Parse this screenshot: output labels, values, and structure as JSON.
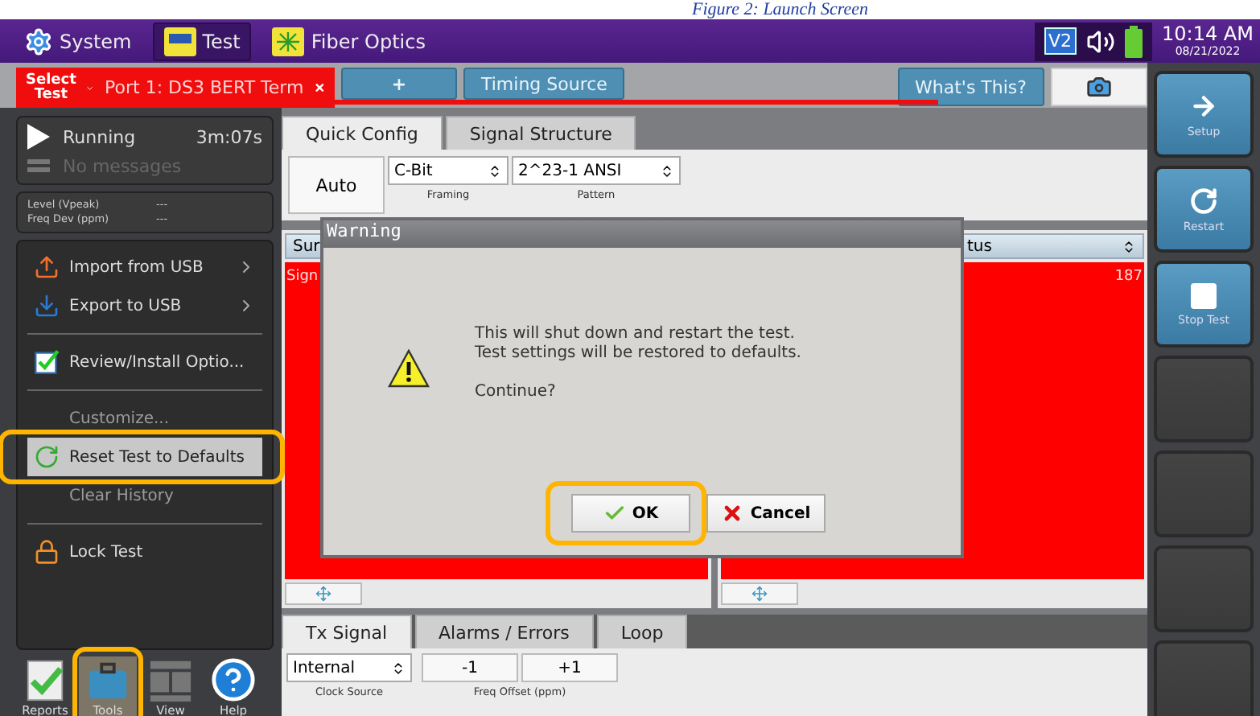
{
  "caption": "Figure 2: Launch Screen",
  "top_bar": {
    "tabs": [
      {
        "label": "System",
        "selected": false
      },
      {
        "label": "Test",
        "selected": true
      },
      {
        "label": "Fiber Optics",
        "selected": false
      }
    ],
    "badge": "V2",
    "time": "10:14 AM",
    "date": "08/21/2022"
  },
  "test_bar": {
    "select_label": "Select Test",
    "port_tab": "Port 1: DS3 BERT Term",
    "add": "+",
    "timing": "Timing Source",
    "whats_this": "What's This?"
  },
  "status_panel": {
    "state": "Running",
    "elapsed": "3m:07s",
    "message": "No messages",
    "readings": [
      {
        "label": "Level (Vpeak)",
        "value": "---"
      },
      {
        "label": "Freq Dev (ppm)",
        "value": "---"
      }
    ]
  },
  "menu": [
    {
      "kind": "submenu",
      "label": "Import from USB",
      "selected": false,
      "disabled": false
    },
    {
      "kind": "submenu",
      "label": "Export to USB",
      "selected": false,
      "disabled": false
    },
    {
      "kind": "divider"
    },
    {
      "kind": "plain",
      "label": "Review/Install Optio...",
      "selected": false,
      "disabled": false
    },
    {
      "kind": "divider"
    },
    {
      "kind": "plain",
      "label": "Customize...",
      "selected": false,
      "disabled": true
    },
    {
      "kind": "plain",
      "label": "Reset Test to Defaults",
      "selected": true,
      "disabled": false
    },
    {
      "kind": "plain",
      "label": "Clear History",
      "selected": false,
      "disabled": true
    },
    {
      "kind": "divider"
    },
    {
      "kind": "plain",
      "label": "Lock Test",
      "selected": false,
      "disabled": false
    }
  ],
  "dock": [
    {
      "label": "Reports",
      "selected": false
    },
    {
      "label": "Tools",
      "selected": true
    },
    {
      "label": "View",
      "selected": false
    },
    {
      "label": "Help",
      "selected": false
    }
  ],
  "config_tabs": [
    {
      "label": "Quick Config",
      "selected": true
    },
    {
      "label": "Signal Structure",
      "selected": false
    }
  ],
  "config": {
    "auto": "Auto",
    "fields": [
      {
        "value": "C-Bit",
        "caption": "Framing"
      },
      {
        "value": "2^23-1 ANSI",
        "caption": "Pattern"
      }
    ]
  },
  "result_panels": [
    {
      "header": "Sur",
      "row_label": "Sign"
    },
    {
      "header": "tus",
      "value": "187"
    }
  ],
  "bottom_tabs": [
    {
      "label": "Tx Signal",
      "selected": true
    },
    {
      "label": "Alarms / Errors",
      "selected": false
    },
    {
      "label": "Loop",
      "selected": false
    }
  ],
  "tx_signal": {
    "clock": {
      "value": "Internal",
      "caption": "Clock Source"
    },
    "offset_buttons": [
      "-1",
      "+1"
    ],
    "offset_caption": "Freq Offset (ppm)"
  },
  "dialog": {
    "title": "Warning",
    "message": [
      "This will shut down and restart the test.",
      "Test settings will be restored to defaults."
    ],
    "question": "Continue?",
    "buttons": [
      {
        "kind": "ok",
        "label": "OK"
      },
      {
        "kind": "cancel",
        "label": "Cancel"
      }
    ]
  },
  "side_buttons": [
    {
      "kind": "setup",
      "label": "Setup"
    },
    {
      "kind": "restart",
      "label": "Restart"
    },
    {
      "kind": "stop",
      "label": "Stop Test"
    },
    {
      "kind": "empty"
    },
    {
      "kind": "empty"
    },
    {
      "kind": "empty"
    },
    {
      "kind": "empty"
    }
  ]
}
